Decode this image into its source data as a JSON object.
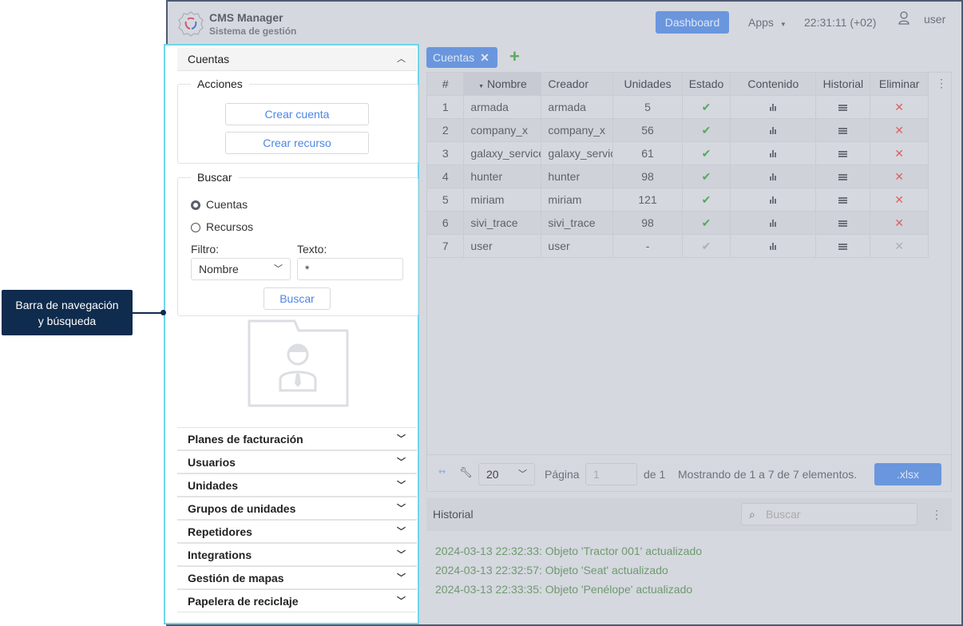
{
  "header": {
    "title": "CMS Manager",
    "subtitle": "Sistema de gestión",
    "dashboard": "Dashboard",
    "apps": "Apps",
    "time": "22:31:11 (+02)",
    "user": "user"
  },
  "callout": {
    "line1": "Barra de navegación",
    "line2": "y búsqueda"
  },
  "sidebar": {
    "section": "Cuentas",
    "actions": {
      "legend": "Acciones",
      "create_account": "Crear cuenta",
      "create_resource": "Crear recurso"
    },
    "search": {
      "legend": "Buscar",
      "radio_accounts": "Cuentas",
      "radio_resources": "Recursos",
      "filter_label": "Filtro:",
      "filter_value": "Nombre",
      "text_label": "Texto:",
      "text_value": "*",
      "button": "Buscar"
    },
    "items": [
      "Planes de facturación",
      "Usuarios",
      "Unidades",
      "Grupos de unidades",
      "Repetidores",
      "Integrations",
      "Gestión de mapas",
      "Papelera de reciclaje"
    ]
  },
  "tabs": {
    "active": "Cuentas"
  },
  "table": {
    "columns": [
      "#",
      "Nombre",
      "Creador",
      "Unidades",
      "Estado",
      "Contenido",
      "Historial",
      "Eliminar"
    ],
    "rows": [
      {
        "n": "1",
        "name": "armada",
        "creator": "armada",
        "units": "5",
        "active": true
      },
      {
        "n": "2",
        "name": "company_x",
        "creator": "company_x",
        "units": "56",
        "active": true
      },
      {
        "n": "3",
        "name": "galaxy_service",
        "creator": "galaxy_service",
        "units": "61",
        "active": true
      },
      {
        "n": "4",
        "name": "hunter",
        "creator": "hunter",
        "units": "98",
        "active": true
      },
      {
        "n": "5",
        "name": "miriam",
        "creator": "miriam",
        "units": "121",
        "active": true
      },
      {
        "n": "6",
        "name": "sivi_trace",
        "creator": "sivi_trace",
        "units": "98",
        "active": true
      },
      {
        "n": "7",
        "name": "user",
        "creator": "user",
        "units": "-",
        "active": false
      }
    ]
  },
  "pager": {
    "per_page": "20",
    "page_label": "Página",
    "page": "1",
    "of": "de 1",
    "showing": "Mostrando de 1 a 7 de 7 elementos.",
    "export": ".xlsx"
  },
  "history": {
    "title": "Historial",
    "search_placeholder": "Buscar",
    "entries": [
      "2024-03-13 22:32:33: Objeto 'Tractor 001' actualizado",
      "2024-03-13 22:32:57: Objeto 'Seat' actualizado",
      "2024-03-13 22:33:35: Objeto 'Penélope' actualizado"
    ]
  }
}
